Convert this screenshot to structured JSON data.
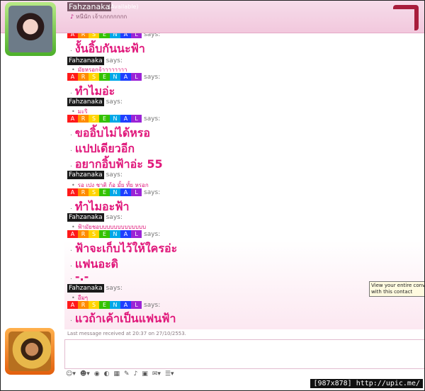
{
  "header": {
    "contact_name": "Fahzanaka",
    "contact_status": "(Available)",
    "personal_message": "หนีนัก เจ้าเกกกกกกก"
  },
  "arsenal_letters": [
    "A",
    "R",
    "S",
    "E",
    "N",
    "A",
    "L"
  ],
  "arsenal_colors": [
    "#ff1a1a",
    "#ff8c00",
    "#ffd400",
    "#33c200",
    "#00a8e8",
    "#1f3fff",
    "#9b24d6"
  ],
  "says": "says:",
  "fah_tag": "Fahzanaka",
  "messages": {
    "m1": "งั้นอิ้บกันนะฟ้า",
    "m2": "มัยหรอกจ้าาาาาาาา",
    "m3": "ทำไมอ่ะ",
    "m4": "มะริ",
    "m5": "ขออิ้บไม่ได้หรอ",
    "m6": "แปปเดียวอีก",
    "m7": "อยากอิ้บฟ้าอ่ะ 55",
    "m8": "รอ เปง ชาติ ก้อ มั้ย ทั้ย หรอก",
    "m9": "ทำไมอะฟ้า",
    "m10": "ฟ้ามัยชอบบบบบบบบบบบบบ",
    "m11": "ฟ้าจะเก็บไว้ให้ใครอ่ะ",
    "m12": "แฟนอะดิ",
    "m13": "-.-",
    "m14": "อืมๆ",
    "m15": "แวถ้าเค้าเป็นแฟนฟ้า"
  },
  "tooltip": {
    "line1": "View your entire conver",
    "line2": "with this contact"
  },
  "last_message": "Last message received at 20:37 on 27/10/2553.",
  "input": {
    "value": "",
    "placeholder": ""
  },
  "toolbar": [
    "☺▾",
    "☻▾",
    "◉",
    "◐",
    "▦",
    "✎",
    "♪",
    "▣",
    "✉▾",
    "☰▾"
  ],
  "watermark": "[987x878] http://upic.me/"
}
